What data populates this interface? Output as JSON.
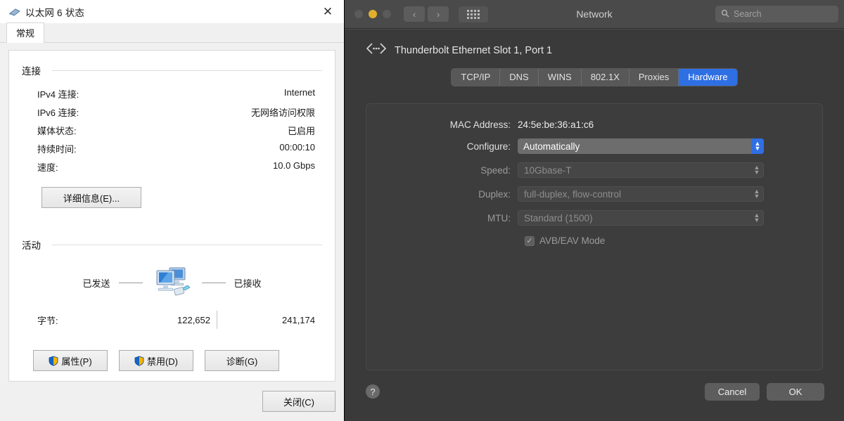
{
  "windows_dialog": {
    "title": "以太网 6 状态",
    "title_icon": "network-adapter-icon",
    "close_icon": "close-icon",
    "tab": "常规",
    "connection": {
      "legend": "连接",
      "rows": [
        {
          "key": "IPv4 连接:",
          "value": "Internet"
        },
        {
          "key": "IPv6 连接:",
          "value": "无网络访问权限"
        },
        {
          "key": "媒体状态:",
          "value": "已启用"
        },
        {
          "key": "持续时间:",
          "value": "00:00:10"
        },
        {
          "key": "速度:",
          "value": "10.0 Gbps"
        }
      ],
      "details_button": "详细信息(E)..."
    },
    "activity": {
      "legend": "活动",
      "sent_label": "已发送",
      "received_label": "已接收",
      "graphic_icon": "computers-network-cable-icon",
      "bytes_label": "字节:",
      "bytes_sent": "122,652",
      "bytes_received": "241,174"
    },
    "actions": {
      "properties": "属性(P)",
      "disable": "禁用(D)",
      "diagnose": "诊断(G)",
      "shield_icon": "uac-shield-icon"
    },
    "close_button": "关闭(C)"
  },
  "mac_window": {
    "title": "Network",
    "traffic_lights": [
      {
        "name": "close-button",
        "color": "#5a5a5a"
      },
      {
        "name": "minimize-button",
        "color": "#e0b02c"
      },
      {
        "name": "zoom-button",
        "color": "#5a5a5a"
      }
    ],
    "nav": {
      "back_icon": "chevron-left-icon",
      "forward_icon": "chevron-right-icon",
      "grid_icon": "show-all-grid-icon"
    },
    "search": {
      "placeholder": "Search",
      "icon": "search-icon"
    },
    "interface": {
      "icon": "thunderbolt-ethernet-icon",
      "name": "Thunderbolt Ethernet Slot  1, Port 1"
    },
    "tabs": [
      {
        "label": "TCP/IP",
        "selected": false
      },
      {
        "label": "DNS",
        "selected": false
      },
      {
        "label": "WINS",
        "selected": false
      },
      {
        "label": "802.1X",
        "selected": false
      },
      {
        "label": "Proxies",
        "selected": false
      },
      {
        "label": "Hardware",
        "selected": true
      }
    ],
    "form": {
      "mac_address_label": "MAC Address:",
      "mac_address_value": "24:5e:be:36:a1:c6",
      "configure_label": "Configure:",
      "configure_value": "Automatically",
      "speed_label": "Speed:",
      "speed_value": "10Gbase-T",
      "duplex_label": "Duplex:",
      "duplex_value": "full-duplex, flow-control",
      "mtu_label": "MTU:",
      "mtu_value": "Standard  (1500)",
      "avb_label": "AVB/EAV Mode",
      "avb_checked": true
    },
    "footer": {
      "help_icon": "help-question-icon",
      "cancel": "Cancel",
      "ok": "OK"
    },
    "accent_color": "#2f6fe4"
  }
}
